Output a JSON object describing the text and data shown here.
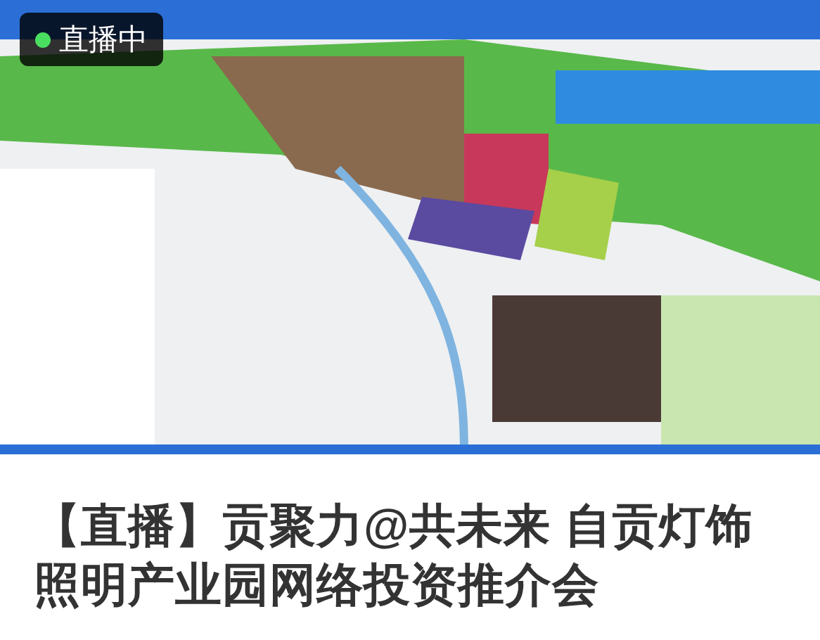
{
  "video": {
    "kind": "picture",
    "live_badge": {
      "label": "直播中",
      "live": true
    }
  },
  "article": {
    "title": "【直播】贡聚力@共未来 自贡灯饰照明产业园网络投资推介会"
  }
}
